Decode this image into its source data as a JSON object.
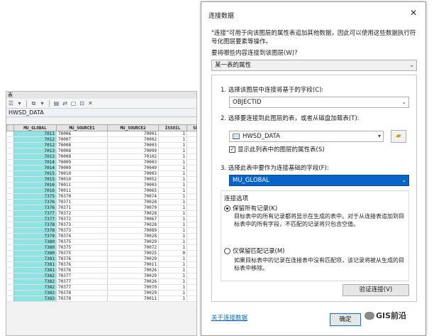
{
  "table_window": {
    "title": "表",
    "layer_tab": "HWSD_DATA",
    "columns": [
      "MU_GLOBAL",
      "MU_SOURCE1",
      "MU_SOURCE2",
      "ISSOIL",
      "SHA"
    ],
    "rows": [
      [
        "7011",
        "70006",
        "70001",
        "1"
      ],
      [
        "7012",
        "70007",
        "70002",
        "1"
      ],
      [
        "7012",
        "70008",
        "70003",
        "1"
      ],
      [
        "7013",
        "70008",
        "70099",
        "1"
      ],
      [
        "7013",
        "70008",
        "70102",
        "1"
      ],
      [
        "7014",
        "70009",
        "70003",
        "1"
      ],
      [
        "7014",
        "70009",
        "70049",
        "1"
      ],
      [
        "7015",
        "70010",
        "70003",
        "1"
      ],
      [
        "7015",
        "70010",
        "70052",
        "1"
      ],
      [
        "7016",
        "70011",
        "70003",
        "1"
      ],
      [
        "7016",
        "70011",
        "70065",
        "1"
      ],
      [
        "7375",
        "70370",
        "70074",
        "1"
      ],
      [
        "7376",
        "70371",
        "70028",
        "1"
      ],
      [
        "7376",
        "70371",
        "70079",
        "1"
      ],
      [
        "7377",
        "70372",
        "70028",
        "1"
      ],
      [
        "7377",
        "70372",
        "70067",
        "1"
      ],
      [
        "7378",
        "70373",
        "70028",
        "1"
      ],
      [
        "7378",
        "70373",
        "70089",
        "1"
      ],
      [
        "7379",
        "70374",
        "70028",
        "1"
      ],
      [
        "7380",
        "70375",
        "70029",
        "1"
      ],
      [
        "7380",
        "70375",
        "70072",
        "1"
      ],
      [
        "7380",
        "70375",
        "70025",
        "0"
      ],
      [
        "7381",
        "70376",
        "70029",
        "1"
      ],
      [
        "7381",
        "70376",
        "70011",
        "1"
      ],
      [
        "7381",
        "70376",
        "70026",
        "1"
      ],
      [
        "7382",
        "70377",
        "70029",
        "1"
      ],
      [
        "7382",
        "70377",
        "70026",
        "1"
      ],
      [
        "7382",
        "70377",
        "70070",
        "1"
      ],
      [
        "7383",
        "70378",
        "70029",
        "1"
      ],
      [
        "7383",
        "70378",
        "70011",
        "1"
      ]
    ]
  },
  "dialog": {
    "title": "连接数据",
    "close_glyph": "✕",
    "description": "\"连接\"可用于向该图层的属性表追加其他数据，因此可以使用这些数据执行符号化图层要素等操作。",
    "question_label": "要将哪些内容连接到该图层(W)?",
    "join_type_value": "某一表的属性",
    "step1_label": "1. 选择该图层中连接将基于的字段(C):",
    "step1_value": "OBJECTID",
    "step2_label": "2. 选择要连接到此图层的表，或者从磁盘加载表(T):",
    "step2_value": "HWSD_DATA",
    "show_attr_label": "显示此列表中的图层的属性表(S)",
    "step3_label": "3. 选择此表中要作为连接基础的字段(F):",
    "step3_value": "MU_GLOBAL",
    "options_title": "连接选项",
    "keep_all_label": "保留所有记录(K)",
    "keep_all_desc": "目标表中的所有记录都将显示在生成的表中。对于从连接表追加到目标表中的所有字段，不匹配的记录将只包含空值。",
    "keep_match_label": "仅保留匹配记录(M)",
    "keep_match_desc": "如果目标表中的记录在连接表中没有匹配项，该记录将被从生成的目标表中移除。",
    "validate_label": "验证连接(V)",
    "about_link": "关于连接数据",
    "ok_label": "确定",
    "watermark": "GIS前沿"
  }
}
